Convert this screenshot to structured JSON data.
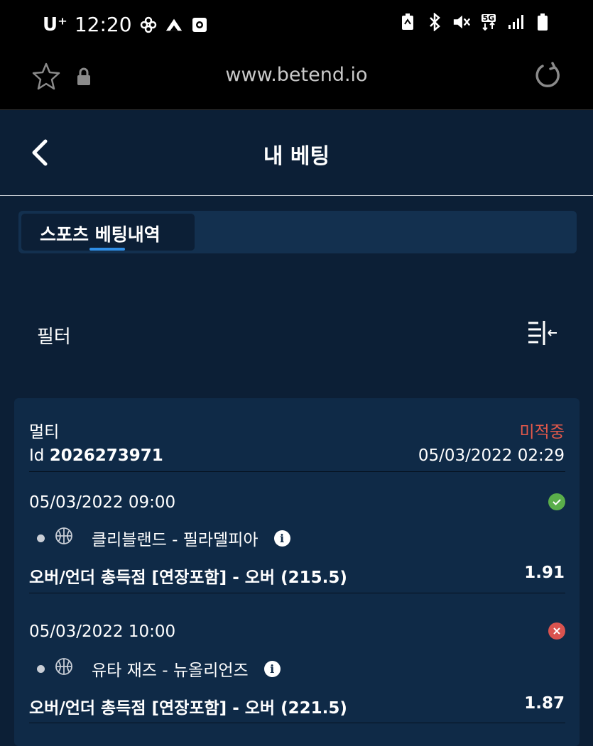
{
  "status_bar": {
    "carrier": "U⁺",
    "time": "12:20",
    "network": "5G"
  },
  "browser": {
    "url": "www.betend.io"
  },
  "header": {
    "title": "내 베팅"
  },
  "tabs": [
    {
      "label": "스포츠 베팅내역",
      "active": true
    }
  ],
  "filter": {
    "label": "필터"
  },
  "bet": {
    "type": "멀티",
    "status": "미적중",
    "id_label": "Id",
    "id": "2026273971",
    "datetime": "05/03/2022 02:29",
    "selections": [
      {
        "datetime": "05/03/2022 09:00",
        "result": "won",
        "match": "클리블랜드 - 필라델피아",
        "market": "오버/언더 총득점 [연장포함] - 오버 (215.5)",
        "odds": "1.91",
        "result_icon": "check-icon"
      },
      {
        "datetime": "05/03/2022 10:00",
        "result": "lost",
        "match": "유타 재즈 - 뉴올리언즈",
        "market": "오버/언더 총득점 [연장포함] - 오버 (221.5)",
        "odds": "1.87",
        "result_icon": "cross-icon"
      }
    ]
  },
  "colors": {
    "background": "#0c1f36",
    "card": "#0f2a47",
    "lost": "#e0584a",
    "won": "#5aae4a",
    "accent": "#2f8ee6"
  }
}
